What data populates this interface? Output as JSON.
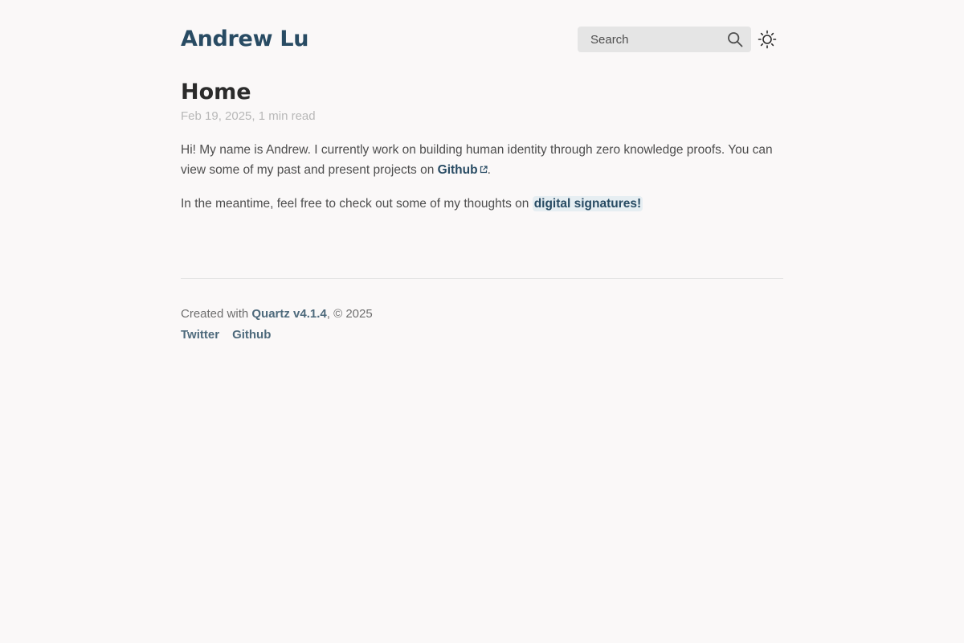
{
  "header": {
    "site_title": "Andrew Lu",
    "search_label": "Search",
    "theme_icon": "sun-icon"
  },
  "article": {
    "title": "Home",
    "meta": "Feb 19, 2025, 1 min read",
    "paragraph1": {
      "text_before": "Hi! My name is Andrew. I currently work on building human identity through zero knowledge proofs. You can view some of my past and present projects on ",
      "link_label": "Github",
      "text_after": "."
    },
    "paragraph2": {
      "text_before": "In the meantime, feel free to check out some of my thoughts on ",
      "link_label": "digital signatures!"
    }
  },
  "footer": {
    "credit_prefix": "Created with ",
    "credit_link": "Quartz v4.1.4",
    "credit_suffix": ", © 2025",
    "links": [
      "Twitter",
      "Github"
    ]
  },
  "colors": {
    "background": "#faf8f8",
    "accent": "#284b63",
    "search_bg": "#e5e5e5"
  }
}
